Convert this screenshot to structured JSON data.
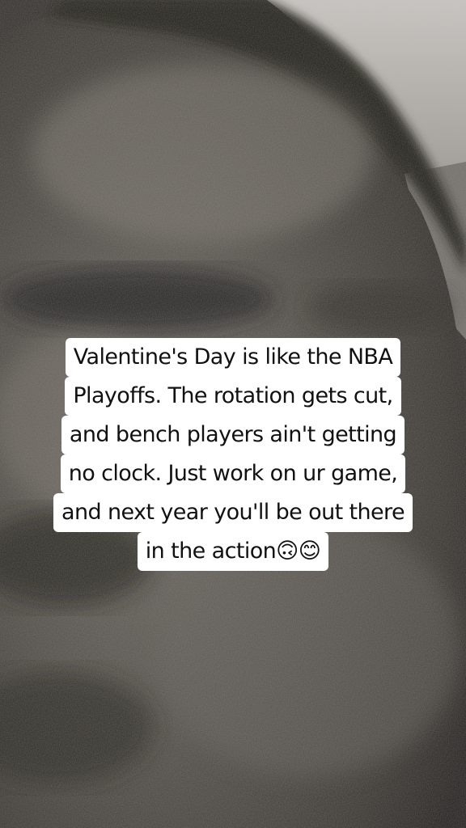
{
  "caption": {
    "lines": [
      "Valentine's Day is like the NBA",
      "Playoffs.  The rotation gets cut,",
      "and bench players ain't getting",
      "no clock.  Just work on ur game,",
      "and next year you'll be out there",
      "in the action🙃😊"
    ]
  }
}
